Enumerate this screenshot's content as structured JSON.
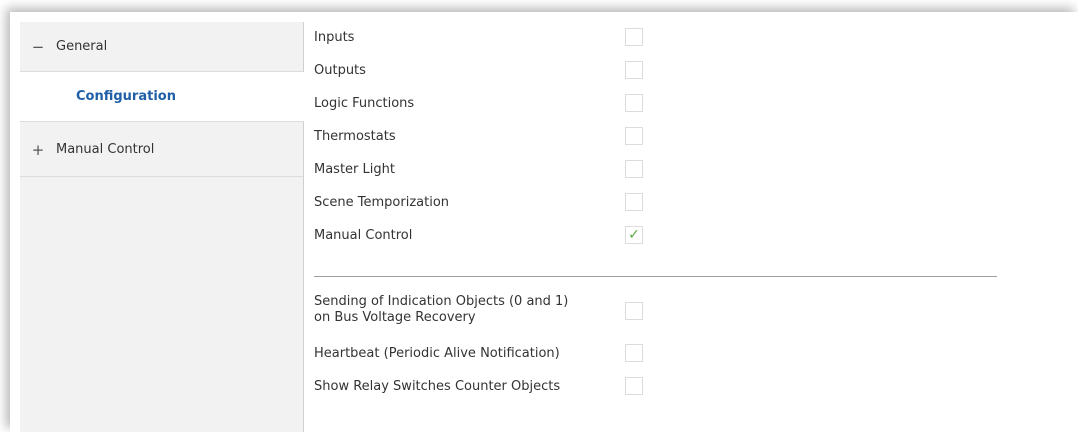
{
  "sidebar": {
    "general": {
      "toggle": "−",
      "label": "General"
    },
    "configuration": {
      "label": "Configuration"
    },
    "manual_control": {
      "toggle": "+",
      "label": "Manual Control"
    }
  },
  "options": [
    {
      "label": "Inputs",
      "checked": false
    },
    {
      "label": "Outputs",
      "checked": false
    },
    {
      "label": "Logic Functions",
      "checked": false
    },
    {
      "label": "Thermostats",
      "checked": false
    },
    {
      "label": "Master Light",
      "checked": false
    },
    {
      "label": "Scene Temporization",
      "checked": false
    },
    {
      "label": "Manual Control",
      "checked": true,
      "mark": "✓"
    }
  ],
  "extra_options": [
    {
      "label": "Sending of Indication Objects (0 and 1) on Bus Voltage Recovery",
      "checked": false
    },
    {
      "label": "Heartbeat (Periodic Alive Notification)",
      "checked": false
    },
    {
      "label": "Show Relay Switches Counter Objects",
      "checked": false
    }
  ],
  "colors": {
    "selected_text": "#1f5fa8",
    "check": "#5aaa46"
  }
}
